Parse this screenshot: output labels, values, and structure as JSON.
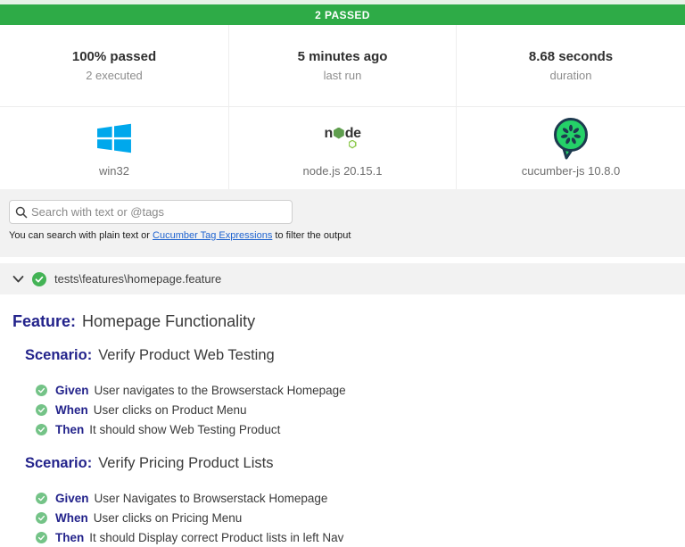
{
  "banner": {
    "label": "2 PASSED"
  },
  "summary": {
    "stats": [
      {
        "title": "100% passed",
        "subtitle": "2 executed"
      },
      {
        "title": "5 minutes ago",
        "subtitle": "last run"
      },
      {
        "title": "8.68 seconds",
        "subtitle": "duration"
      }
    ],
    "env": [
      {
        "icon": "windows-icon",
        "label": "win32"
      },
      {
        "icon": "nodejs-icon",
        "label": "node.js 20.15.1"
      },
      {
        "icon": "cucumber-icon",
        "label": "cucumber-js 10.8.0"
      }
    ]
  },
  "search": {
    "placeholder": "Search with text or @tags",
    "help_prefix": "You can search with plain text or ",
    "help_link": "Cucumber Tag Expressions",
    "help_suffix": " to filter the output"
  },
  "feature_file": {
    "path": "tests\\features\\homepage.feature"
  },
  "report": {
    "feature_keyword": "Feature:",
    "feature_name": "Homepage Functionality",
    "scenarios": [
      {
        "keyword": "Scenario:",
        "name": "Verify Product Web Testing",
        "steps": [
          {
            "keyword": "Given",
            "text": "User navigates to the Browserstack Homepage"
          },
          {
            "keyword": "When",
            "text": "User clicks on Product Menu"
          },
          {
            "keyword": "Then",
            "text": "It should show Web Testing Product"
          }
        ]
      },
      {
        "keyword": "Scenario:",
        "name": "Verify Pricing Product Lists",
        "steps": [
          {
            "keyword": "Given",
            "text": "User Navigates to Browserstack Homepage"
          },
          {
            "keyword": "When",
            "text": "User clicks on Pricing Menu"
          },
          {
            "keyword": "Then",
            "text": "It should Display correct Product lists in left Nav"
          }
        ]
      }
    ]
  },
  "colors": {
    "banner_green": "#2eab47",
    "keyword_navy": "#23238b",
    "step_check_green": "#74c387",
    "status_check_green": "#43b355",
    "windows_blue": "#00a8ec",
    "node_green": "#5f9e4e",
    "cucumber_green": "#24d168",
    "cucumber_dark": "#1d3a4f",
    "link_blue": "#1e63d0",
    "section_gray": "#f2f2f2"
  }
}
